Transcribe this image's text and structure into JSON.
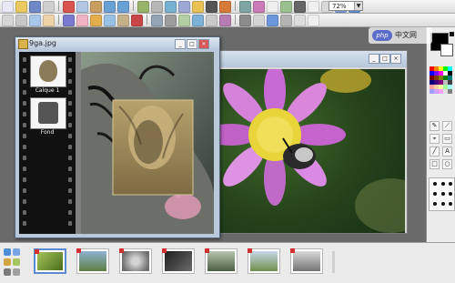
{
  "toolbar": {
    "zoom_value": "72%"
  },
  "jpg_window": {
    "title": "9ga.jpg"
  },
  "layers": [
    {
      "label": "Calque 1"
    },
    {
      "label": "Fond"
    }
  ],
  "watermark": {
    "logo": "php",
    "text": "中文网"
  },
  "colors": {
    "flower_petal": "#b45ac4",
    "flower_center": "#e7d530",
    "foreground": "#000000",
    "workspace_bg": "#6a6a6a"
  }
}
